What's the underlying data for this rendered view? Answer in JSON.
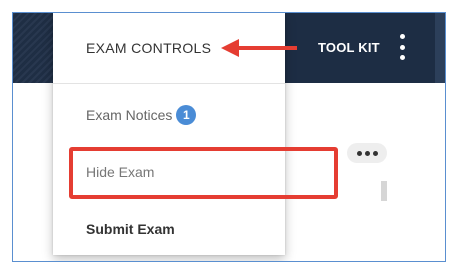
{
  "topbar": {
    "toolkit_label": "TOOL KIT",
    "menu_icon": "kebab-vertical-icon"
  },
  "menu": {
    "header_label": "EXAM CONTROLS",
    "items": [
      {
        "label": "Exam Notices",
        "badge": "1"
      },
      {
        "label": "Hide Exam"
      },
      {
        "label": "Submit Exam"
      }
    ]
  },
  "content": {
    "more_icon": "more-horizontal-icon"
  },
  "colors": {
    "topbar": "#1d2d44",
    "badge": "#4a8cd6",
    "annotation": "#e53d32",
    "frame": "#5a8fd0"
  }
}
